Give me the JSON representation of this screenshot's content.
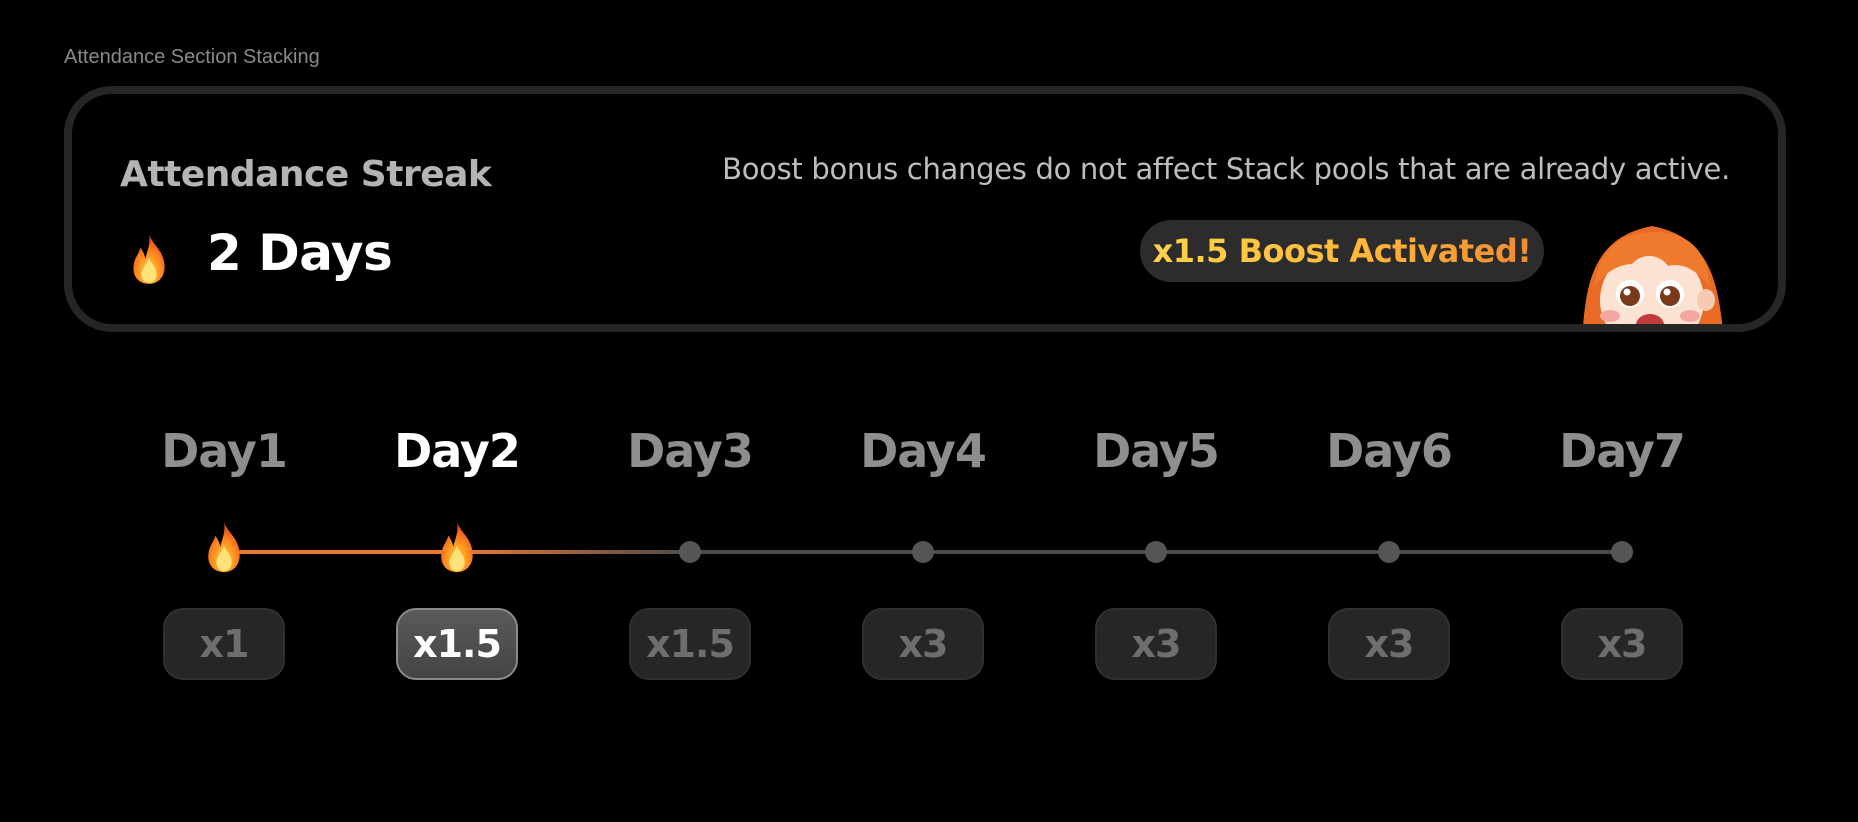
{
  "frame_label": "Attendance Section Stacking",
  "streak": {
    "title": "Attendance Streak",
    "days_text": "2 Days",
    "notice": "Boost bonus changes do not affect Stack pools that are already active.",
    "boost_badge": "x1.5 Boost Activated!",
    "icon": "fire-icon",
    "mascot": "surprised-girl-mascot"
  },
  "timeline": {
    "current_day": 2,
    "completed_days": 2,
    "days": [
      {
        "label": "Day1",
        "multiplier": "x1"
      },
      {
        "label": "Day2",
        "multiplier": "x1.5"
      },
      {
        "label": "Day3",
        "multiplier": "x1.5"
      },
      {
        "label": "Day4",
        "multiplier": "x3"
      },
      {
        "label": "Day5",
        "multiplier": "x3"
      },
      {
        "label": "Day6",
        "multiplier": "x3"
      },
      {
        "label": "Day7",
        "multiplier": "x3"
      }
    ]
  },
  "colors": {
    "background": "#000000",
    "accent_orange": "#ef7a2e",
    "boost_yellow": "#ffc83a",
    "card_border": "#262626",
    "inactive_text": "#8e8e8e"
  }
}
